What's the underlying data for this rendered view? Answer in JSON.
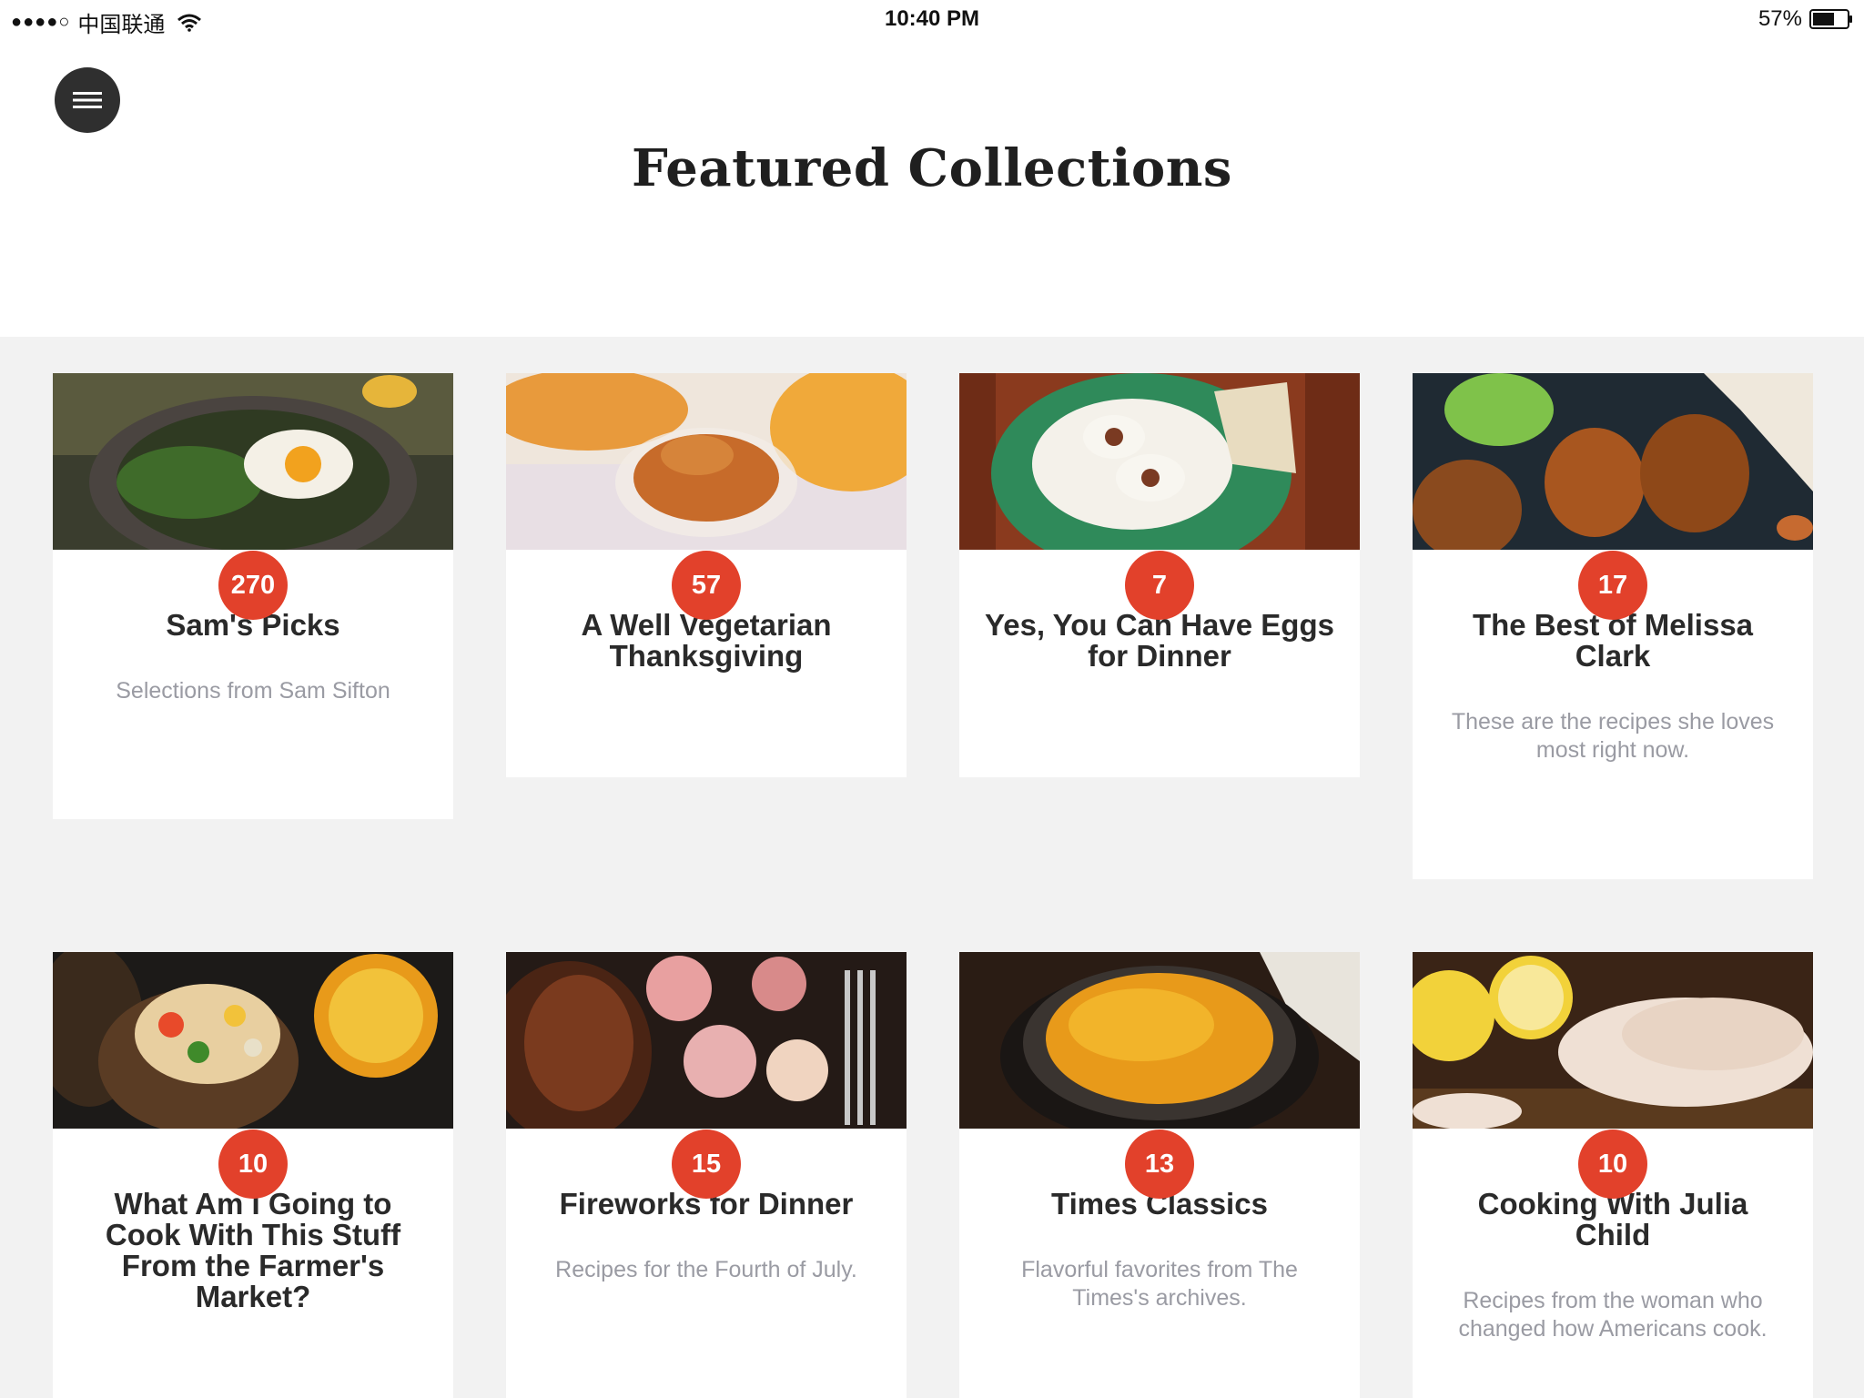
{
  "status_bar": {
    "carrier": "中国联通",
    "time": "10:40 PM",
    "battery": "57%"
  },
  "header": {
    "title": "Featured Collections"
  },
  "collections": [
    {
      "count": "270",
      "title": "Sam's Picks",
      "subtitle": "Selections from Sam Sifton"
    },
    {
      "count": "57",
      "title": "A Well Vegetarian Thanksgiving",
      "subtitle": ""
    },
    {
      "count": "7",
      "title": "Yes, You Can Have Eggs for Dinner",
      "subtitle": ""
    },
    {
      "count": "17",
      "title": "The Best of Melissa Clark",
      "subtitle": "These are the recipes she loves most right now."
    },
    {
      "count": "10",
      "title": "What Am I Going to Cook With This Stuff From the Farmer's Market?",
      "subtitle": ""
    },
    {
      "count": "15",
      "title": "Fireworks for Dinner",
      "subtitle": "Recipes for the Fourth of July."
    },
    {
      "count": "13",
      "title": "Times Classics",
      "subtitle": "Flavorful favorites from The Times's archives."
    },
    {
      "count": "10",
      "title": "Cooking With Julia Child",
      "subtitle": "Recipes from the woman who changed how Americans cook."
    }
  ],
  "colors": {
    "badge": "#e2412b",
    "background": "#f2f2f2",
    "menu_button": "#2f2f2f"
  }
}
